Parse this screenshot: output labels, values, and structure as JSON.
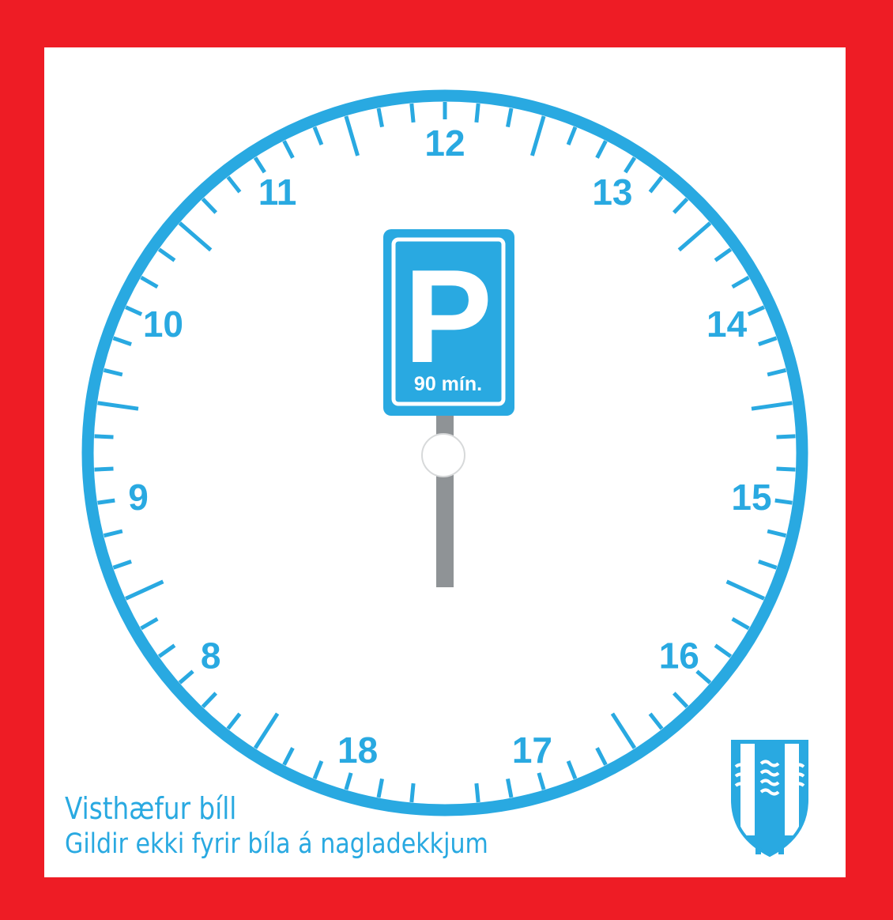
{
  "hours": [
    "12",
    "13",
    "14",
    "15",
    "16",
    "17",
    "18",
    "8",
    "9",
    "10",
    "11"
  ],
  "sign": {
    "letter": "P",
    "duration": "90 mín."
  },
  "caption": {
    "line1": "Visthæfur bíll",
    "line2": "Gildir ekki fyrir bíla á nagladekkjum"
  },
  "colors": {
    "background": "#EE1C25",
    "card": "#FFFFFF",
    "accent": "#29A9E1",
    "pointer": "#8F9396"
  },
  "icons": {
    "coat_of_arms": "municipal-coat-of-arms-icon"
  }
}
